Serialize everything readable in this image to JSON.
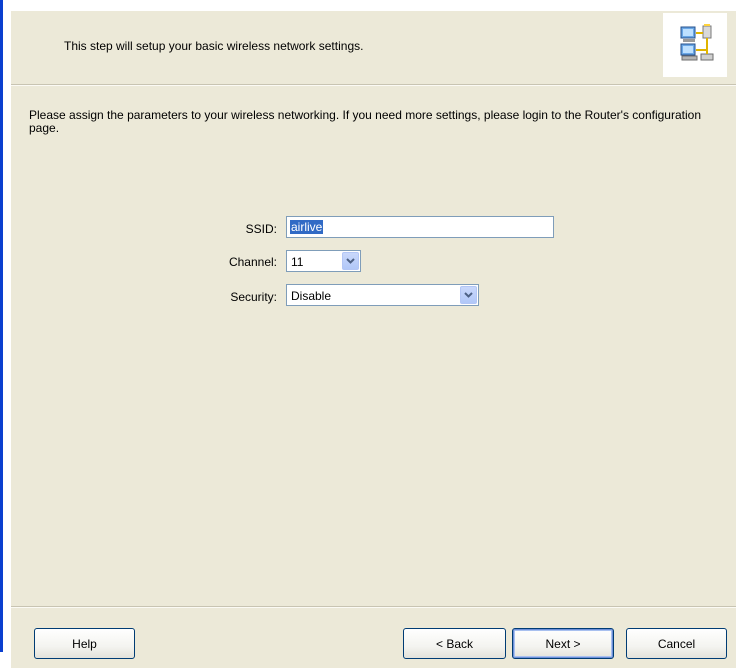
{
  "header": {
    "description": "This step will setup your basic wireless network settings.",
    "icon": "network-computers-icon"
  },
  "intro": "Please assign the parameters to your wireless networking. If you need more settings, please login to the Router's configuration page.",
  "form": {
    "ssid_label": "SSID:",
    "ssid_value": "airlive",
    "channel_label": "Channel:",
    "channel_value": "11",
    "security_label": "Security:",
    "security_value": "Disable"
  },
  "buttons": {
    "help": "Help",
    "back": "< Back",
    "next": "Next >",
    "cancel": "Cancel"
  },
  "colors": {
    "dialog_bg": "#ece9d8",
    "selection": "#316ac5",
    "left_accent": "#0a3fcf",
    "button_border": "#003c74"
  }
}
